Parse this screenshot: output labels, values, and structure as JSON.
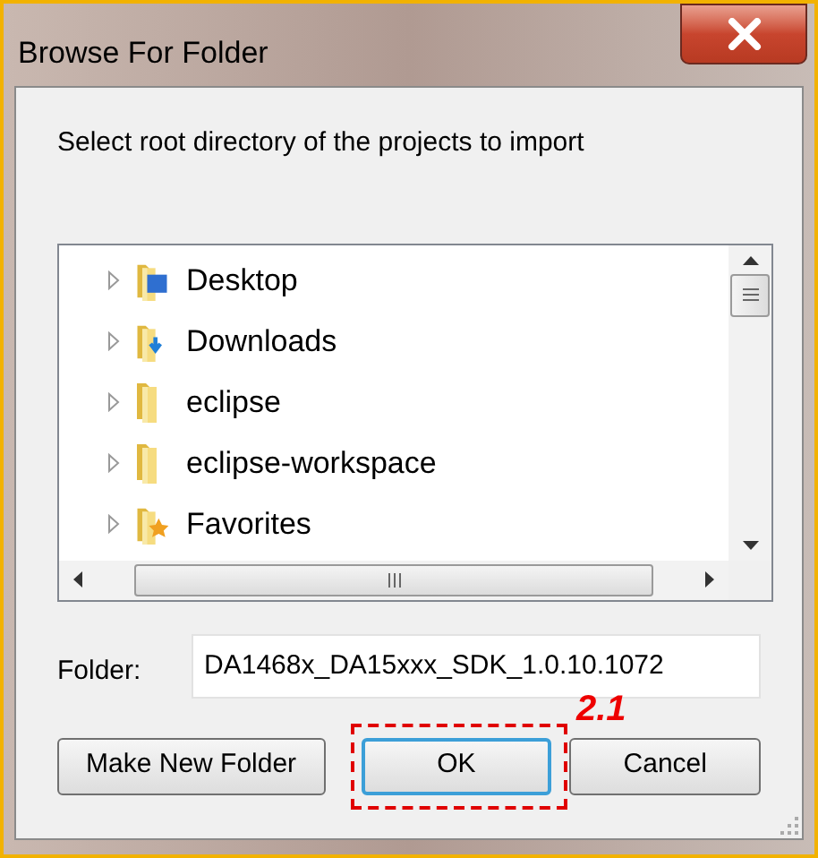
{
  "window": {
    "title": "Browse For Folder"
  },
  "prompt": "Select root directory of the projects to import",
  "tree": {
    "items": [
      {
        "label": "Desktop",
        "kind": "desktop",
        "expanded": false
      },
      {
        "label": "Downloads",
        "kind": "downloads",
        "expanded": false
      },
      {
        "label": "eclipse",
        "kind": "folder",
        "expanded": false
      },
      {
        "label": "eclipse-workspace",
        "kind": "folder",
        "expanded": false
      },
      {
        "label": "Favorites",
        "kind": "favorites",
        "expanded": false
      }
    ]
  },
  "folder": {
    "label": "Folder:",
    "value": "DA1468x_DA15xxx_SDK_1.0.10.1072"
  },
  "buttons": [
    {
      "label": "Make New Folder",
      "default": false
    },
    {
      "label": "OK",
      "default": true
    },
    {
      "label": "Cancel",
      "default": false
    }
  ],
  "annotation": {
    "label": "2.1"
  }
}
